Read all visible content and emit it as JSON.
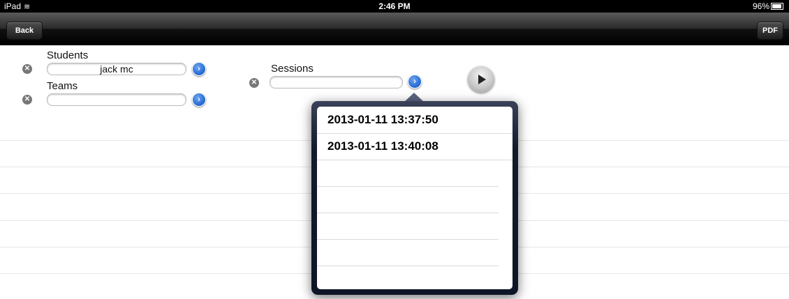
{
  "status_bar": {
    "device": "iPad",
    "time": "2:46 PM",
    "battery": "96%"
  },
  "toolbar": {
    "back_label": "Back",
    "pdf_label": "PDF"
  },
  "form": {
    "students_label": "Students",
    "students_value": "jack mc",
    "teams_label": "Teams",
    "teams_value": "",
    "sessions_label": "Sessions",
    "sessions_value": ""
  },
  "sessions_popover": {
    "items": [
      {
        "label": "2013-01-11 13:37:50"
      },
      {
        "label": "2013-01-11 13:40:08"
      }
    ]
  },
  "icons": {
    "clear": "clear-circle-icon",
    "disclosure": "blue-disclosure-arrow-icon",
    "play": "play-icon",
    "wifi": "wifi-icon",
    "battery": "battery-icon"
  }
}
